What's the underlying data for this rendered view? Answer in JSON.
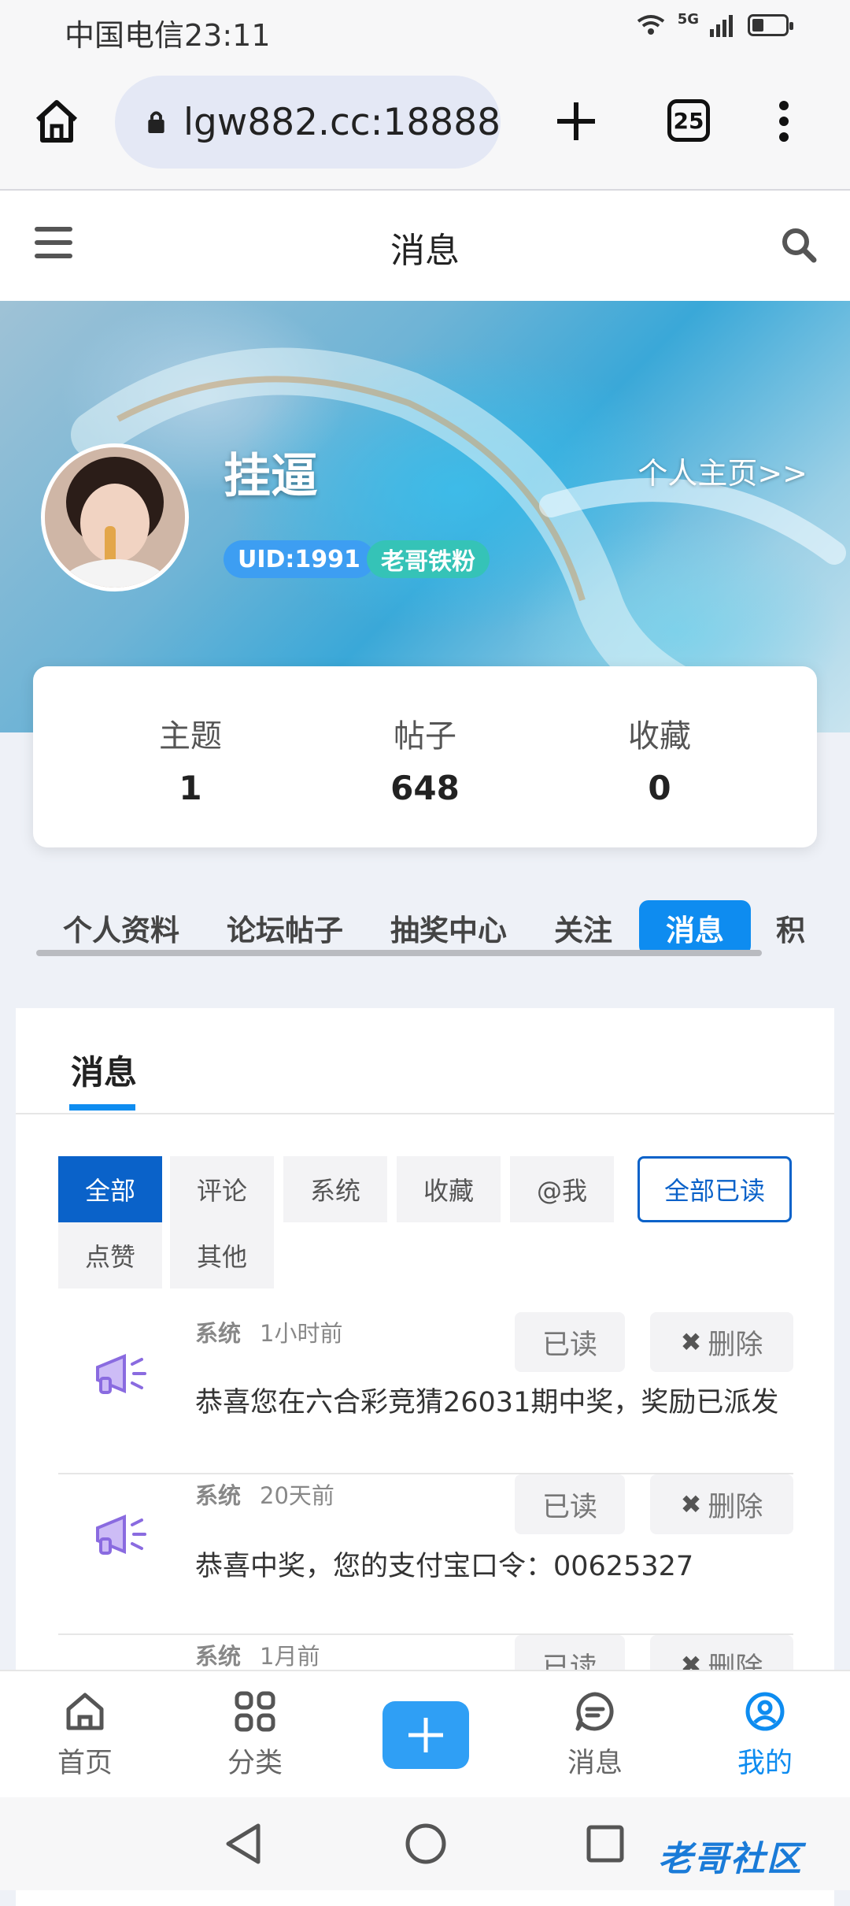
{
  "status_bar": {
    "carrier_time": "中国电信23:11",
    "network": "5G"
  },
  "browser": {
    "url": "lgw882.cc:18888",
    "tab_count": "25"
  },
  "header": {
    "title": "消息"
  },
  "profile": {
    "username": "挂逼",
    "homepage_link": "个人主页>>",
    "uid_badge": "UID:1991",
    "rank_badge": "老哥铁粉"
  },
  "stats": [
    {
      "label": "主题",
      "value": "1"
    },
    {
      "label": "帖子",
      "value": "648"
    },
    {
      "label": "收藏",
      "value": "0"
    }
  ],
  "profile_tabs": [
    "个人资料",
    "论坛帖子",
    "抽奖中心",
    "关注",
    "消息",
    "积"
  ],
  "messages_panel": {
    "title": "消息",
    "filters": [
      "全部",
      "评论",
      "系统",
      "收藏",
      "@我",
      "点赞",
      "其他"
    ],
    "mark_all_read": "全部已读",
    "items": [
      {
        "type": "系统",
        "time": "1小时前",
        "text": "恭喜您在六合彩竞猜26031期中奖，奖励已派发",
        "read_label": "已读",
        "delete_label": "删除"
      },
      {
        "type": "系统",
        "time": "20天前",
        "text": "恭喜中奖，您的支付宝口令：00625327",
        "read_label": "已读",
        "delete_label": "删除"
      },
      {
        "type": "系统",
        "time": "1月前",
        "text": "",
        "read_label": "已读",
        "delete_label": "删除"
      }
    ]
  },
  "bottom_nav": [
    {
      "label": "首页",
      "icon": "home-icon"
    },
    {
      "label": "分类",
      "icon": "grid-icon"
    },
    {
      "label": "",
      "icon": "plus-icon"
    },
    {
      "label": "消息",
      "icon": "chat-icon"
    },
    {
      "label": "我的",
      "icon": "user-icon"
    }
  ],
  "watermark": "老哥社区",
  "colors": {
    "accent": "#0e8cf0",
    "filter_active": "#0a62c9",
    "uid_badge": "#3d9ef2",
    "rank_badge": "#35c3b7"
  }
}
